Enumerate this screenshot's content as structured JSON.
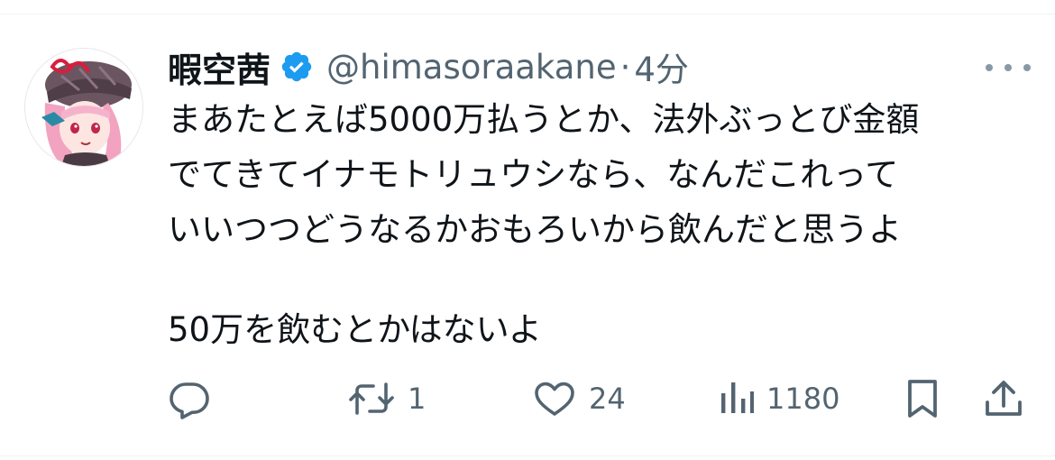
{
  "tweet": {
    "display_name": "暇空茜",
    "handle": "@himasoraakane",
    "separator": "·",
    "time": "4分",
    "body_lines": [
      "まあたとえば5000万払うとか、法外ぶっとび金額",
      "でてきてイナモトリュウシなら、なんだこれって",
      "いいつつどうなるかおもろいから飲んだと思うよ",
      "",
      "50万を飲むとかはないよ"
    ]
  },
  "actions": {
    "reply": {
      "icon": "reply-icon",
      "count": ""
    },
    "retweet": {
      "icon": "retweet-icon",
      "count": "1"
    },
    "like": {
      "icon": "heart-icon",
      "count": "24"
    },
    "views": {
      "icon": "views-icon",
      "count": "1180"
    },
    "bookmark": {
      "icon": "bookmark-icon"
    },
    "share": {
      "icon": "share-icon"
    }
  },
  "colors": {
    "verified": "#1d9bf0",
    "text": "#0f1419",
    "secondary": "#536471",
    "icon": "#536471"
  }
}
